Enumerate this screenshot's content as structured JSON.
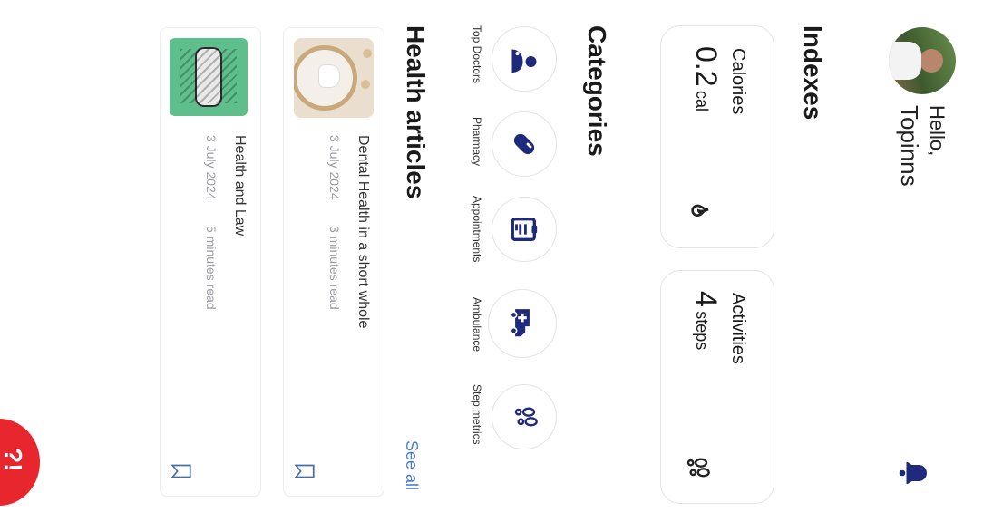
{
  "greeting": {
    "hello": "Hello,",
    "name": "Topinns"
  },
  "indexes": {
    "title": "Indexes",
    "cards": [
      {
        "label": "Calories",
        "value": "0.2",
        "unit": "cal",
        "icon": "fire-icon"
      },
      {
        "label": "Activities",
        "value": "4",
        "unit": "steps",
        "icon": "footsteps-icon"
      }
    ]
  },
  "categories": {
    "title": "Categories",
    "items": [
      {
        "label": "Top Doctors",
        "icon": "doctor-icon"
      },
      {
        "label": "Pharmacy",
        "icon": "pill-icon"
      },
      {
        "label": "Appointments",
        "icon": "clipboard-icon"
      },
      {
        "label": "Ambulance",
        "icon": "ambulance-icon"
      },
      {
        "label": "Step metrics",
        "icon": "footsteps-icon"
      }
    ]
  },
  "articles": {
    "title": "Health articles",
    "see_all": "See all",
    "items": [
      {
        "title": "Dental Health in a short whole",
        "date": "3 July 2024",
        "read_time": "3 minutes read"
      },
      {
        "title": "Health and Law",
        "date": "3 July 2024",
        "read_time": "5 minutes read"
      }
    ]
  },
  "colors": {
    "accent": "#1f2a7c",
    "link": "#4a7bd0",
    "fab": "#e8262d",
    "thumb_green": "#5ebf8c"
  }
}
